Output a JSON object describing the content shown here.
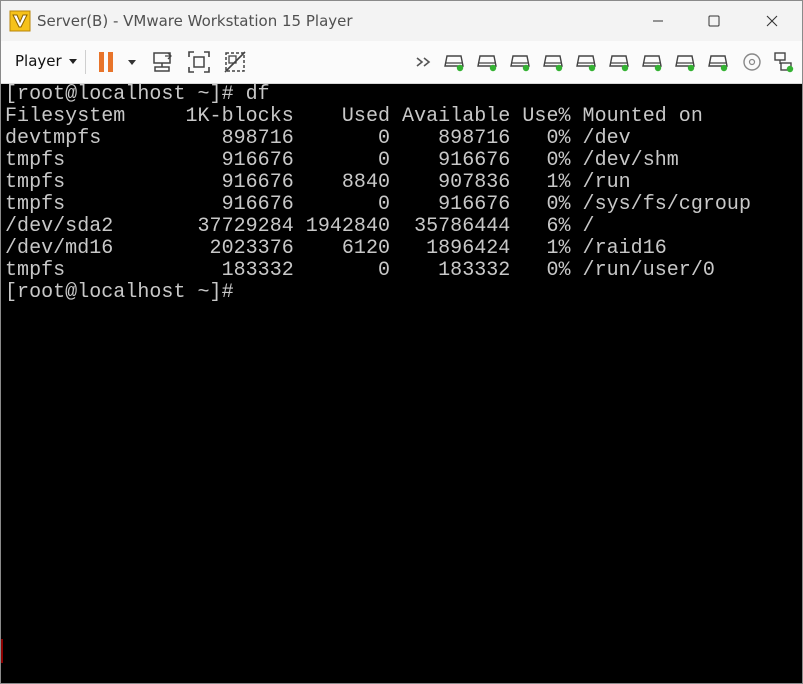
{
  "window": {
    "title": "Server(B) - VMware Workstation 15 Player"
  },
  "toolbar": {
    "player_menu_label": "Player"
  },
  "terminal": {
    "lines": [
      "[root@localhost ~]# df",
      "Filesystem     1K-blocks    Used Available Use% Mounted on",
      "devtmpfs          898716       0    898716   0% /dev",
      "tmpfs             916676       0    916676   0% /dev/shm",
      "tmpfs             916676    8840    907836   1% /run",
      "tmpfs             916676       0    916676   0% /sys/fs/cgroup",
      "/dev/sda2       37729284 1942840  35786444   6% /",
      "/dev/md16        2023376    6120   1896424   1% /raid16",
      "tmpfs             183332       0    183332   0% /run/user/0",
      "[root@localhost ~]#"
    ]
  },
  "icons": {
    "app": "vmware-player-icon",
    "minimize": "minimize-icon",
    "maximize": "maximize-icon",
    "close": "close-icon",
    "pause": "pause-icon",
    "send_ctrl_alt_del": "send-keys-icon",
    "fit_guest": "fit-guest-icon",
    "unity": "unity-icon",
    "expand_devices": "chevron-double-right-icon",
    "hard_disk": "hard-disk-icon",
    "cd_dvd": "cd-dvd-icon",
    "network": "network-adapter-icon"
  },
  "colors": {
    "terminal_bg": "#000000",
    "terminal_fg": "#c8c8c8",
    "pause_accent": "#e8742a",
    "device_active": "#34b233"
  }
}
